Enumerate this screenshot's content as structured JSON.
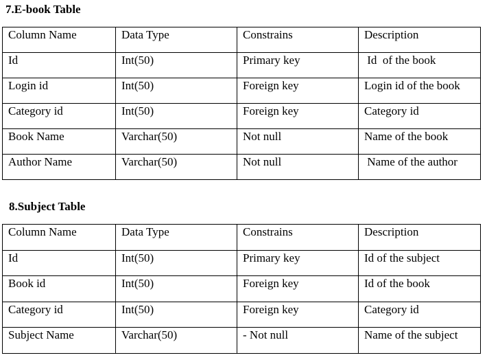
{
  "sections": [
    {
      "heading": "7.E-book Table",
      "columns": [
        "Column Name",
        "Data Type",
        "Constrains",
        "Description"
      ],
      "rows": [
        [
          "Id",
          "Int(50)",
          "Primary key",
          " Id  of the book"
        ],
        [
          "Login id",
          "Int(50)",
          "Foreign key",
          "Login id of the book"
        ],
        [
          "Category id",
          "Int(50)",
          "Foreign key",
          "Category id"
        ],
        [
          "Book Name",
          "Varchar(50)",
          "Not null",
          "Name of the book"
        ],
        [
          "Author Name",
          "Varchar(50)",
          "Not null",
          " Name of the author"
        ]
      ]
    },
    {
      "heading": "8.Subject Table",
      "columns": [
        "Column Name",
        "Data Type",
        "Constrains",
        "Description"
      ],
      "rows": [
        [
          "Id",
          "Int(50)",
          "Primary key",
          "Id of the subject"
        ],
        [
          "Book id",
          "Int(50)",
          "Foreign key",
          "Id of the book"
        ],
        [
          "Category id",
          "Int(50)",
          "Foreign key",
          "Category id"
        ],
        [
          "Subject Name",
          "Varchar(50)",
          "- Not null",
          "Name of the subject"
        ]
      ]
    }
  ]
}
